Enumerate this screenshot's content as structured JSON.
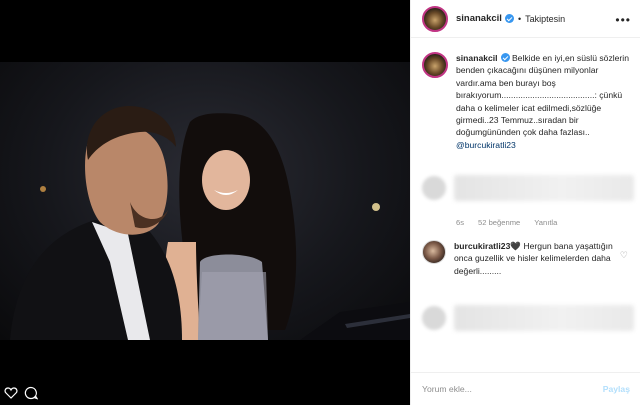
{
  "post": {
    "username": "sinanakcil",
    "follow_status": "Takiptesin",
    "separator": "•",
    "more": "•••"
  },
  "caption": {
    "username": "sinanakcil",
    "text": " Belkide en iyi,en süslü sözlerin benden çıkacağını düşünen milyonlar vardır.ama ben burayı boş bırakıyorum.......................................: çünkü daha o kelimeler icat edilmedi,sözlüğe girmedi..23 Temmuz..sıradan bir doğumgününden çok daha fazlası.. ",
    "mention": "@burcukiratli23"
  },
  "meta": {
    "time": "6s",
    "likes": "52 beğenme",
    "reply": "Yanıtla"
  },
  "reply_comment": {
    "username": "burcukiratli23",
    "emoji": "🖤",
    "text": " Hergun bana yaşattığın onca guzellik ve hisler kelimelerden daha değerli........."
  },
  "footer": {
    "input_placeholder": "Yorum ekle...",
    "share_label": "Paylaş"
  },
  "colors": {
    "verified": "#3897f0",
    "mention": "#003569",
    "share_disabled": "#b2dffc",
    "muted": "#8e8e8e"
  }
}
